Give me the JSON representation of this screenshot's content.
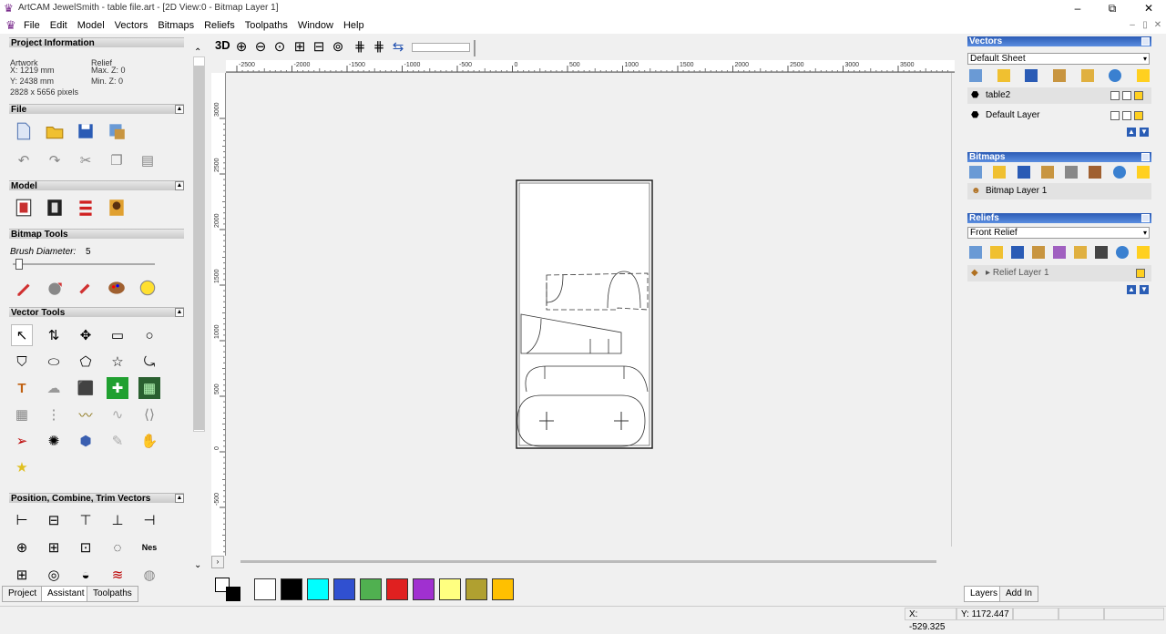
{
  "window": {
    "title": "ArtCAM JewelSmith - table file.art - [2D View:0 - Bitmap Layer 1]",
    "minimize": "–",
    "maximize": "⧉",
    "close": "✕"
  },
  "menu": [
    "File",
    "Edit",
    "Model",
    "Vectors",
    "Bitmaps",
    "Reliefs",
    "Toolpaths",
    "Window",
    "Help"
  ],
  "mdi": {
    "minimize": "–",
    "restore": "▯",
    "close": "✕"
  },
  "left": {
    "project_info": {
      "header": "Project Information",
      "artwork_label": "Artwork",
      "relief_label": "Relief",
      "x": "X: 1219 mm",
      "max_z": "Max. Z: 0",
      "y": "Y: 2438 mm",
      "min_z": "Min. Z: 0",
      "pixels": "2828 x 5656 pixels"
    },
    "file": {
      "header": "File"
    },
    "model": {
      "header": "Model"
    },
    "bitmap_tools": {
      "header": "Bitmap Tools",
      "brush_label": "Brush Diameter:",
      "brush_value": "5"
    },
    "vector_tools": {
      "header": "Vector Tools"
    },
    "position": {
      "header": "Position, Combine, Trim Vectors"
    },
    "tabs": [
      "Project",
      "Assistant",
      "Toolpaths"
    ]
  },
  "toolbar": {
    "three_d": "3D"
  },
  "ruler": {
    "h_ticks": [
      "-2500",
      "-2000",
      "-1500",
      "-1000",
      "-500",
      "0",
      "500",
      "1000",
      "1500",
      "2000",
      "2500",
      "3000",
      "3500"
    ],
    "v_ticks": [
      "3000",
      "2500",
      "2000",
      "1500",
      "1000",
      "500",
      "0",
      "-500"
    ]
  },
  "palette": [
    "#ffffff",
    "#000000",
    "#00ffff",
    "#3050d0",
    "#50b050",
    "#e02020",
    "#a030d0",
    "#ffff80",
    "#b0a030",
    "#ffc000"
  ],
  "right": {
    "vectors": {
      "header": "Vectors",
      "sheet": "Default Sheet",
      "layers": [
        "table2",
        "Default Layer"
      ]
    },
    "bitmaps": {
      "header": "Bitmaps",
      "layer": "Bitmap Layer 1"
    },
    "reliefs": {
      "header": "Reliefs",
      "relief": "Front Relief",
      "layer": "Relief Layer 1"
    },
    "tabs": [
      "Layers",
      "Add In"
    ]
  },
  "status": {
    "x": "X: -529.325",
    "y": "Y: 1172.447"
  }
}
